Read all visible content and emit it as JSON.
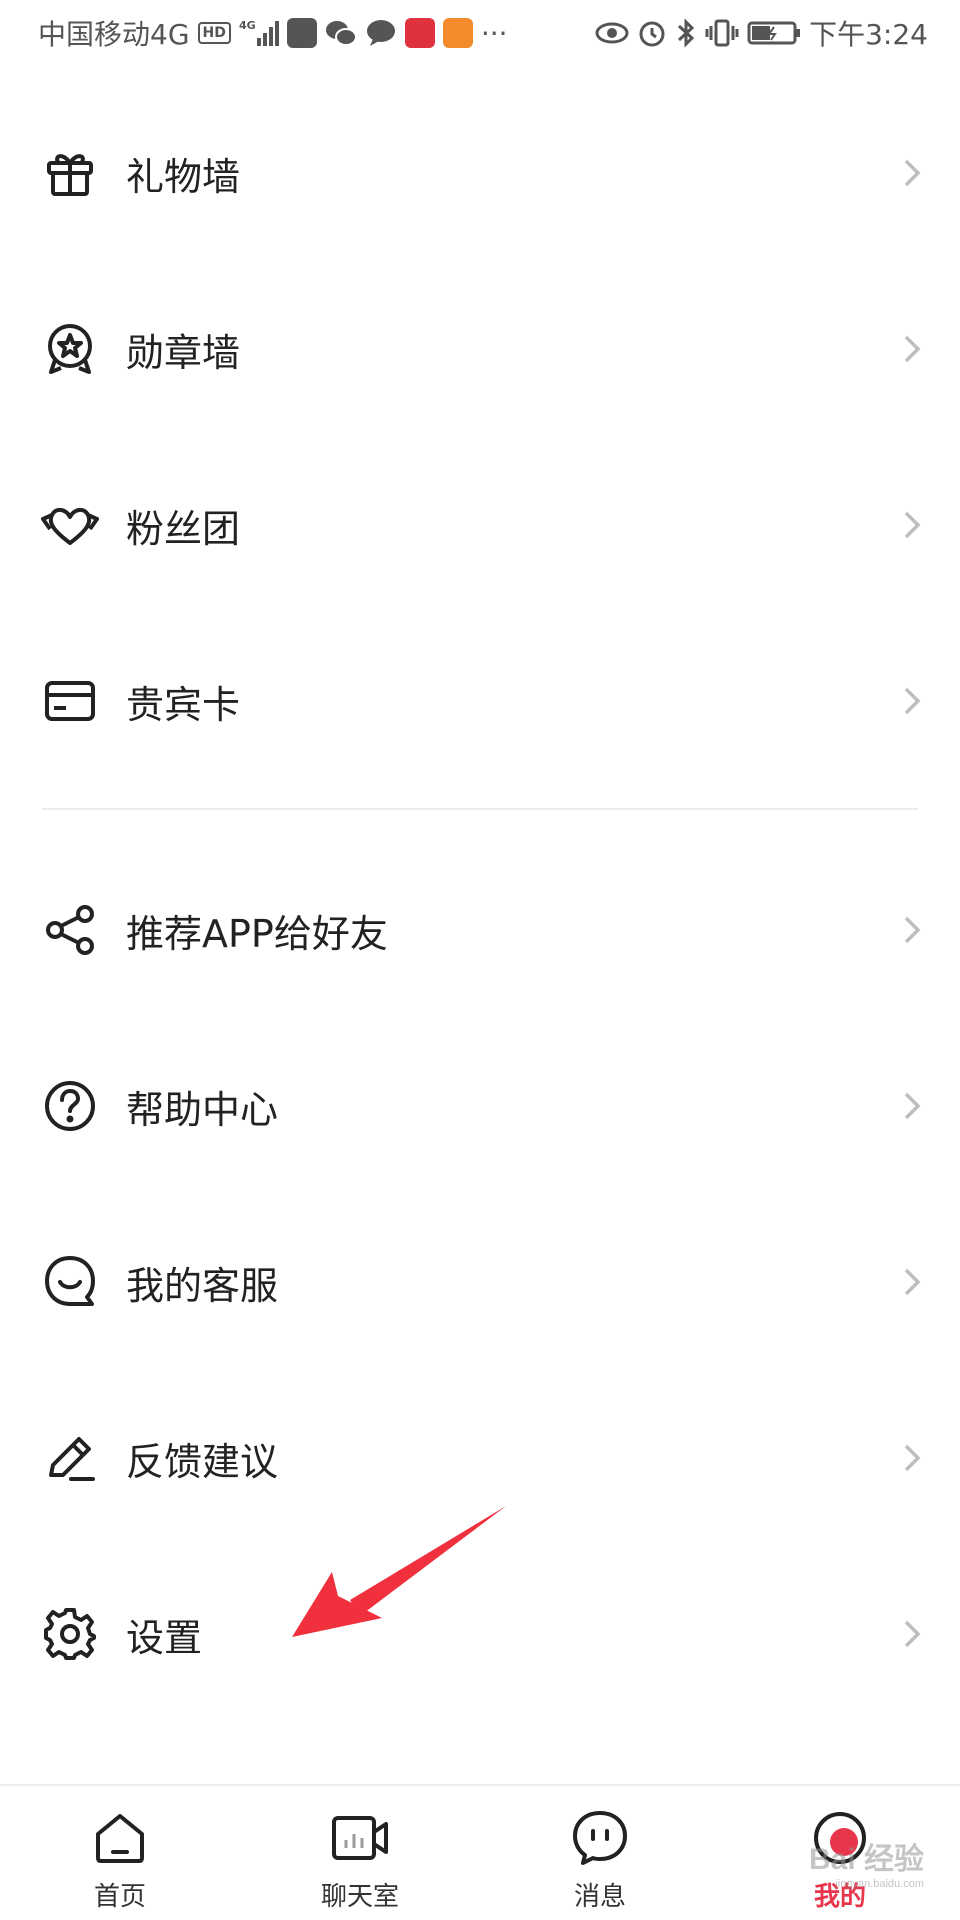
{
  "status_bar": {
    "carrier": "中国移动4G",
    "hd_badge": "HD",
    "network": "4G",
    "more": "···",
    "time": "下午3:24"
  },
  "menu": {
    "items": [
      {
        "label": "礼物墙",
        "icon": "gift-icon"
      },
      {
        "label": "勋章墙",
        "icon": "medal-icon"
      },
      {
        "label": "粉丝团",
        "icon": "heart-hands-icon"
      },
      {
        "label": "贵宾卡",
        "icon": "card-icon"
      },
      {
        "label": "推荐APP给好友",
        "icon": "share-icon"
      },
      {
        "label": "帮助中心",
        "icon": "help-icon"
      },
      {
        "label": "我的客服",
        "icon": "customer-service-icon"
      },
      {
        "label": "反馈建议",
        "icon": "pencil-icon"
      },
      {
        "label": "设置",
        "icon": "gear-icon"
      }
    ]
  },
  "tab_bar": {
    "tabs": [
      {
        "label": "首页",
        "icon": "home-icon",
        "active": false
      },
      {
        "label": "聊天室",
        "icon": "video-room-icon",
        "active": false
      },
      {
        "label": "消息",
        "icon": "message-icon",
        "active": false
      },
      {
        "label": "我的",
        "icon": "profile-icon",
        "active": true
      }
    ]
  },
  "watermark": {
    "text": "Bai 经验",
    "sub": "jingyan.baidu.com"
  },
  "colors": {
    "accent": "#e8364c",
    "arrow": "#f0303d",
    "text": "#222222"
  }
}
